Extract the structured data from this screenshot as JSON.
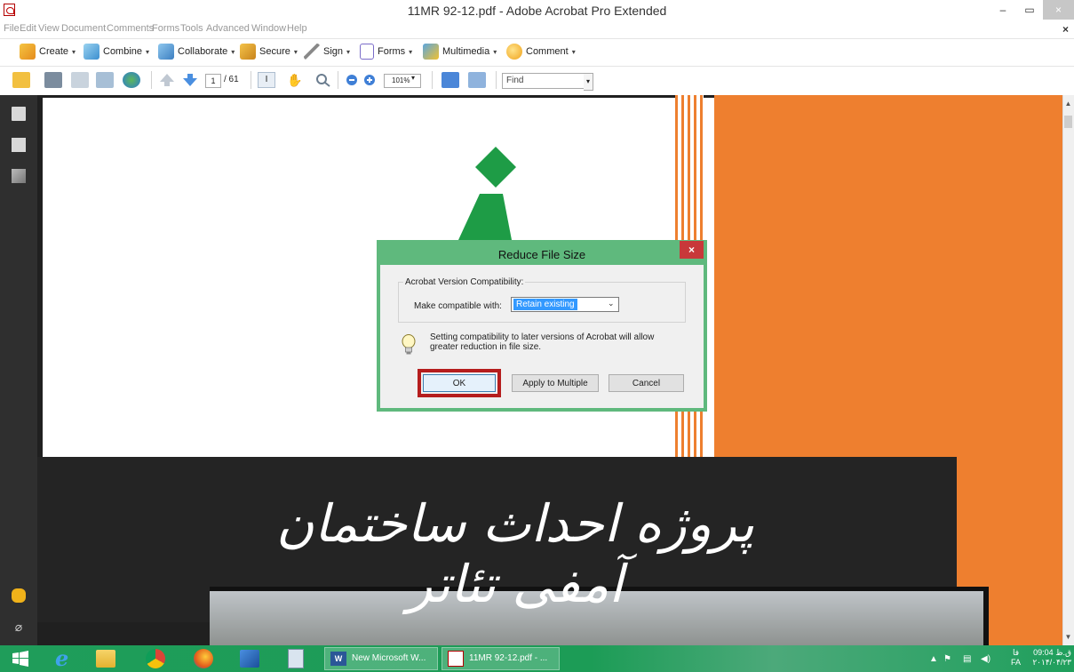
{
  "window": {
    "title": "11MR 92-12.pdf - Adobe Acrobat Pro Extended",
    "minimize": "–",
    "restore": "▭",
    "close": "×",
    "doc_close": "×"
  },
  "menubar": [
    "File",
    "Edit",
    "View",
    "Document",
    "Comments",
    "Forms",
    "Tools",
    "Advanced",
    "Window",
    "Help"
  ],
  "toolbar1": {
    "create": "Create",
    "combine": "Combine",
    "collaborate": "Collaborate",
    "secure": "Secure",
    "sign": "Sign",
    "forms": "Forms",
    "multimedia": "Multimedia",
    "comment": "Comment",
    "caret": "▾"
  },
  "toolbar2": {
    "page_current": "1",
    "page_total": "/ 61",
    "zoom": "101%",
    "find_placeholder": "Find",
    "dropdown_arrow": "▾"
  },
  "document": {
    "persian_title": "پروژه احداث ساختمان آمفی تئاتر"
  },
  "dialog": {
    "title": "Reduce File Size",
    "close": "×",
    "group_label": "Acrobat Version Compatibility:",
    "compat_label": "Make compatible with:",
    "compat_value": "Retain existing",
    "compat_arrow": "⌄",
    "info": "Setting compatibility to later versions of Acrobat will allow greater reduction in file size.",
    "ok": "OK",
    "apply_multiple": "Apply to Multiple",
    "cancel": "Cancel"
  },
  "taskbar": {
    "word_label": "New Microsoft W...",
    "acrobat_label": "11MR 92-12.pdf - ...",
    "lang_top": "فا",
    "lang_bottom": "FA",
    "time": "09:04 ق.ظ",
    "date": "۲۰۱۴/۰۴/۲۳"
  },
  "colors": {
    "dialog_border": "#5fb97d",
    "ok_highlight": "#b51d1d",
    "orange_panel": "#ee7f2f",
    "taskbar": "#1f9d5a",
    "logo_green": "#1e9c46"
  }
}
